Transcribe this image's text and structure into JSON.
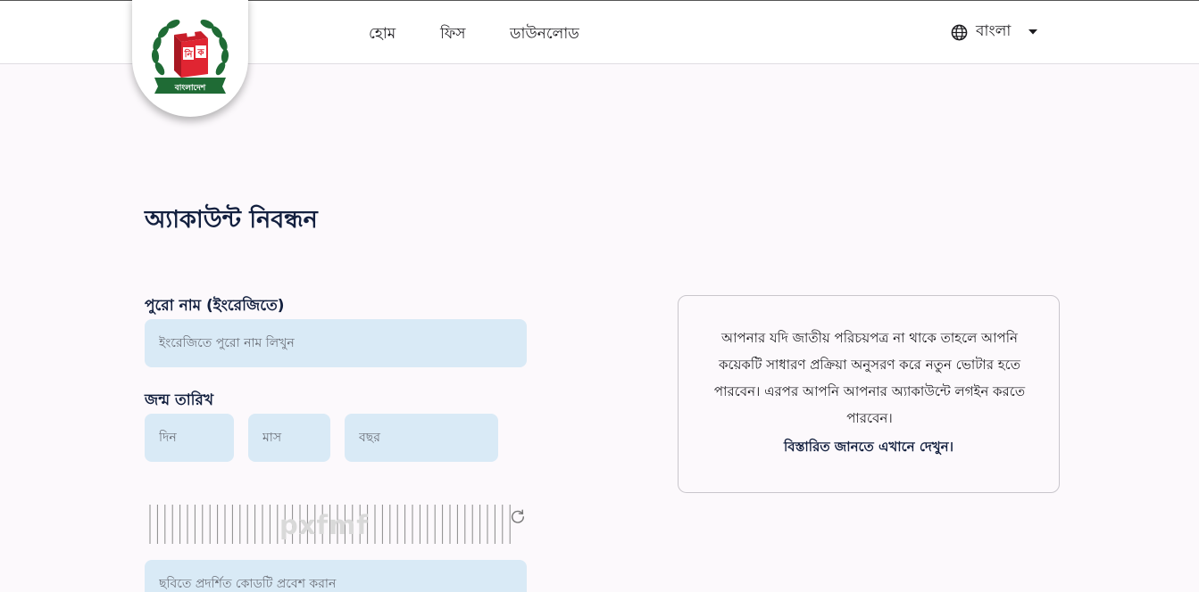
{
  "header": {
    "logo_text_top": "নি",
    "logo_text_right": "ক",
    "logo_ribbon": "বাংলাদেশ",
    "nav": [
      {
        "label": "হোম"
      },
      {
        "label": "ফিস"
      },
      {
        "label": "ডাউনলোড"
      }
    ],
    "language": {
      "selected": "বাংলা",
      "icon": "globe-icon"
    }
  },
  "form": {
    "title": "অ্যাকাউন্ট নিবন্ধন",
    "full_name": {
      "label": "পুরো নাম (ইংরেজিতে)",
      "placeholder": "ইংরেজিতে পুরো নাম লিখুন"
    },
    "dob": {
      "label": "জন্ম তারিখ",
      "day_placeholder": "দিন",
      "month_placeholder": "মাস",
      "year_placeholder": "বছর"
    },
    "captcha": {
      "text": "pxfmf",
      "refresh_icon": "refresh-icon",
      "input_placeholder": "ছবিতে প্রদর্শিত কোডটি প্রবেশ করান"
    }
  },
  "info": {
    "text": "আপনার যদি জাতীয় পরিচয়পত্র না থাকে তাহলে আপনি কয়েকটি সাধারণ প্রক্রিয়া অনুসরণ করে নতুন ভোটার হতে পারবেন। এরপর আপনি আপনার অ্যাকাউন্টে লগইন করতে পারবেন।",
    "link": "বিস্তারিত জানতে এখানে দেখুন।"
  },
  "colors": {
    "input_bg": "#d9eaf6",
    "heading": "#13203f",
    "logo_green": "#1f6b35",
    "logo_red": "#e02532"
  }
}
